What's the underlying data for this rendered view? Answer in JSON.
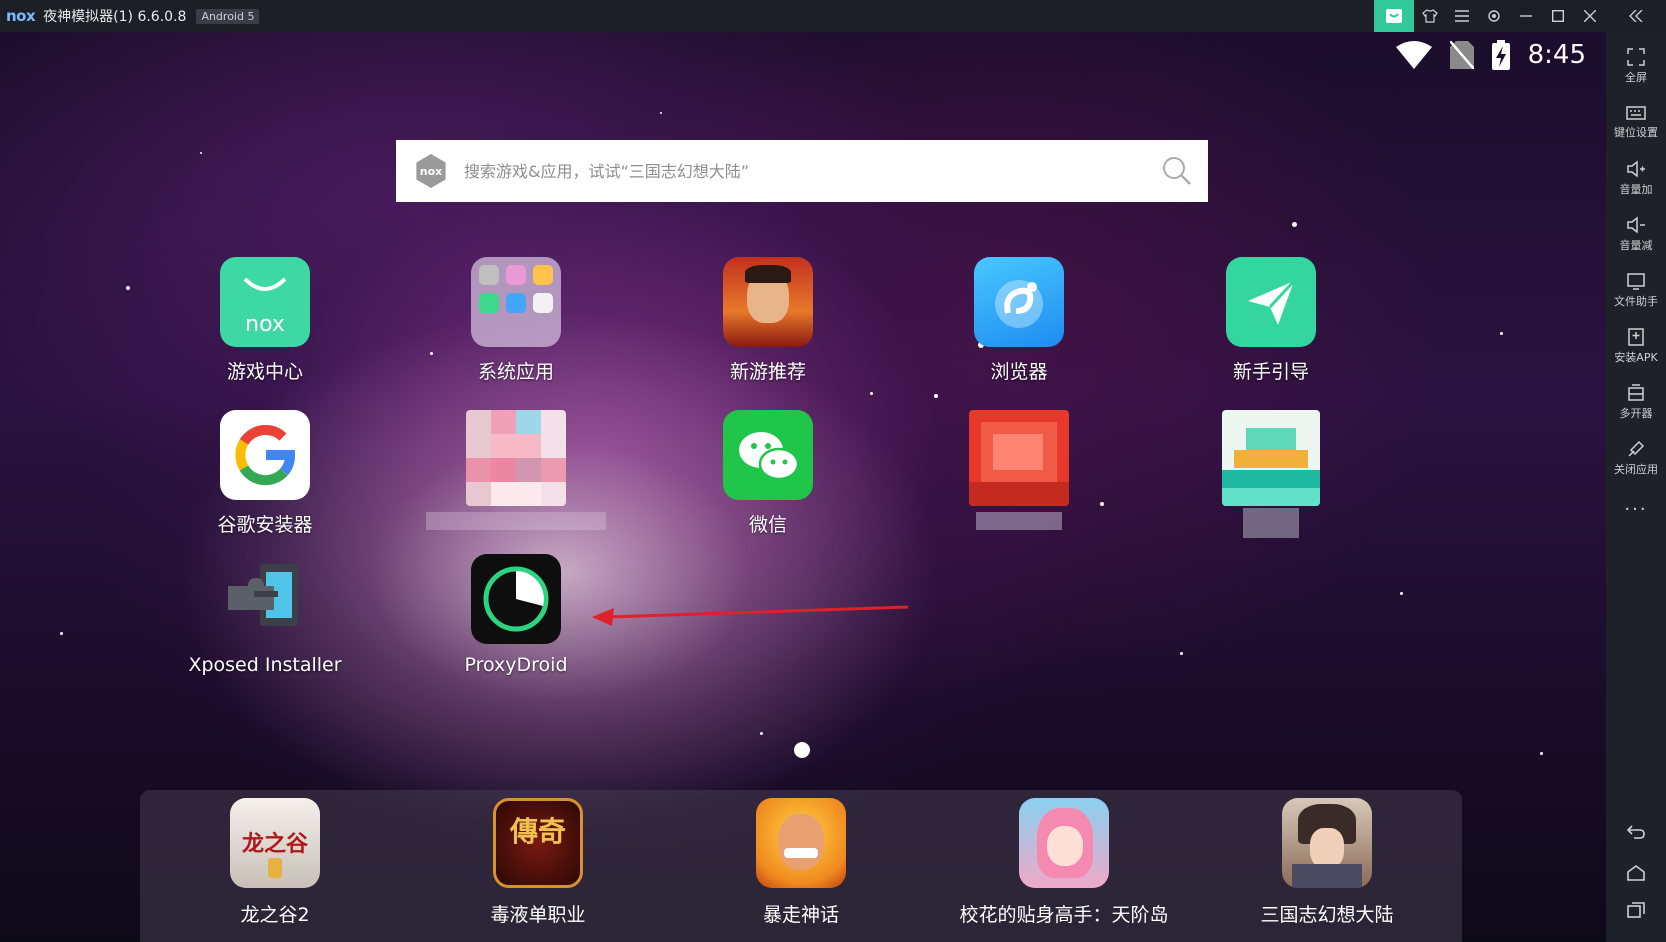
{
  "titlebar": {
    "logo": "nox",
    "title": "夜神模拟器(1) 6.6.0.8",
    "android_badge": "Android 5",
    "buttons": [
      "store-icon",
      "skin-icon",
      "menu-icon",
      "settings-icon",
      "minimize-icon",
      "maximize-icon",
      "close-icon",
      "collapse-icon"
    ]
  },
  "status_bar": {
    "time": "8:45"
  },
  "search": {
    "placeholder": "搜索游戏&应用，试试“三国志幻想大陆”",
    "logo_text": "nox"
  },
  "apps": [
    {
      "label": "游戏中心"
    },
    {
      "label": "系统应用"
    },
    {
      "label": "新游推荐"
    },
    {
      "label": "浏览器"
    },
    {
      "label": "新手引导"
    },
    {
      "label": "谷歌安装器"
    },
    {
      "label": ""
    },
    {
      "label": "微信"
    },
    {
      "label": ""
    },
    {
      "label": ""
    },
    {
      "label": "Xposed Installer"
    },
    {
      "label": "ProxyDroid"
    }
  ],
  "dock": [
    {
      "label": "龙之谷2",
      "icon_text": "龙之谷"
    },
    {
      "label": "毒液单职业",
      "icon_text": "傳奇"
    },
    {
      "label": "暴走神话"
    },
    {
      "label": "校花的贴身高手：天阶岛"
    },
    {
      "label": "三国志幻想大陆"
    }
  ],
  "sidebar": {
    "items": [
      {
        "label": "全屏",
        "icon": "fullscreen-icon"
      },
      {
        "label": "键位设置",
        "icon": "keyboard-icon"
      },
      {
        "label": "音量加",
        "icon": "volume-up-icon"
      },
      {
        "label": "音量减",
        "icon": "volume-down-icon"
      },
      {
        "label": "文件助手",
        "icon": "file-assistant-icon"
      },
      {
        "label": "安装APK",
        "icon": "install-apk-icon"
      },
      {
        "label": "多开器",
        "icon": "multi-instance-icon"
      },
      {
        "label": "关闭应用",
        "icon": "close-app-icon"
      }
    ],
    "more": "...",
    "nav": [
      "back-icon",
      "home-icon",
      "recents-icon"
    ]
  },
  "colors": {
    "accent": "#33c89a",
    "titlebar": "#1d1f26",
    "sidebar": "#1f2128"
  }
}
